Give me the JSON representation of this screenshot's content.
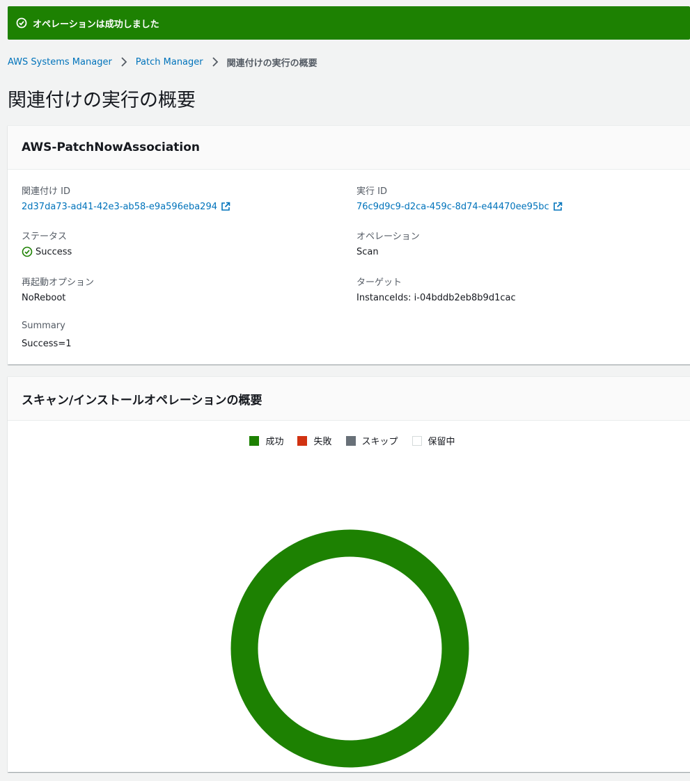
{
  "flash": {
    "message": "オペレーションは成功しました"
  },
  "breadcrumb": {
    "items": [
      "AWS Systems Manager",
      "Patch Manager"
    ],
    "current": "関連付けの実行の概要"
  },
  "page": {
    "title": "関連付けの実行の概要"
  },
  "details": {
    "header": "AWS-PatchNowAssociation",
    "association_id_label": "関連付け ID",
    "association_id": "2d37da73-ad41-42e3-ab58-e9a596eba294",
    "execution_id_label": "実行 ID",
    "execution_id": "76c9d9c9-d2ca-459c-8d74-e44470ee95bc",
    "status_label": "ステータス",
    "status": "Success",
    "operation_label": "オペレーション",
    "operation": "Scan",
    "reboot_label": "再起動オプション",
    "reboot": "NoReboot",
    "target_label": "ターゲット",
    "target": "InstanceIds: i-04bddb2eb8b9d1cac",
    "summary_label": "Summary",
    "summary": "Success=1"
  },
  "chart_panel": {
    "header": "スキャン/インストールオペレーションの概要"
  },
  "colors": {
    "success": "#1d8102",
    "failed": "#d13212",
    "skipped": "#687078",
    "pending": "#ffffff",
    "link": "#0073bb"
  },
  "chart_data": {
    "type": "pie",
    "categories": [
      "成功",
      "失敗",
      "スキップ",
      "保留中"
    ],
    "values": [
      1,
      0,
      0,
      0
    ],
    "colors": [
      "#1d8102",
      "#d13212",
      "#687078",
      "#ffffff"
    ],
    "legend": "top"
  }
}
